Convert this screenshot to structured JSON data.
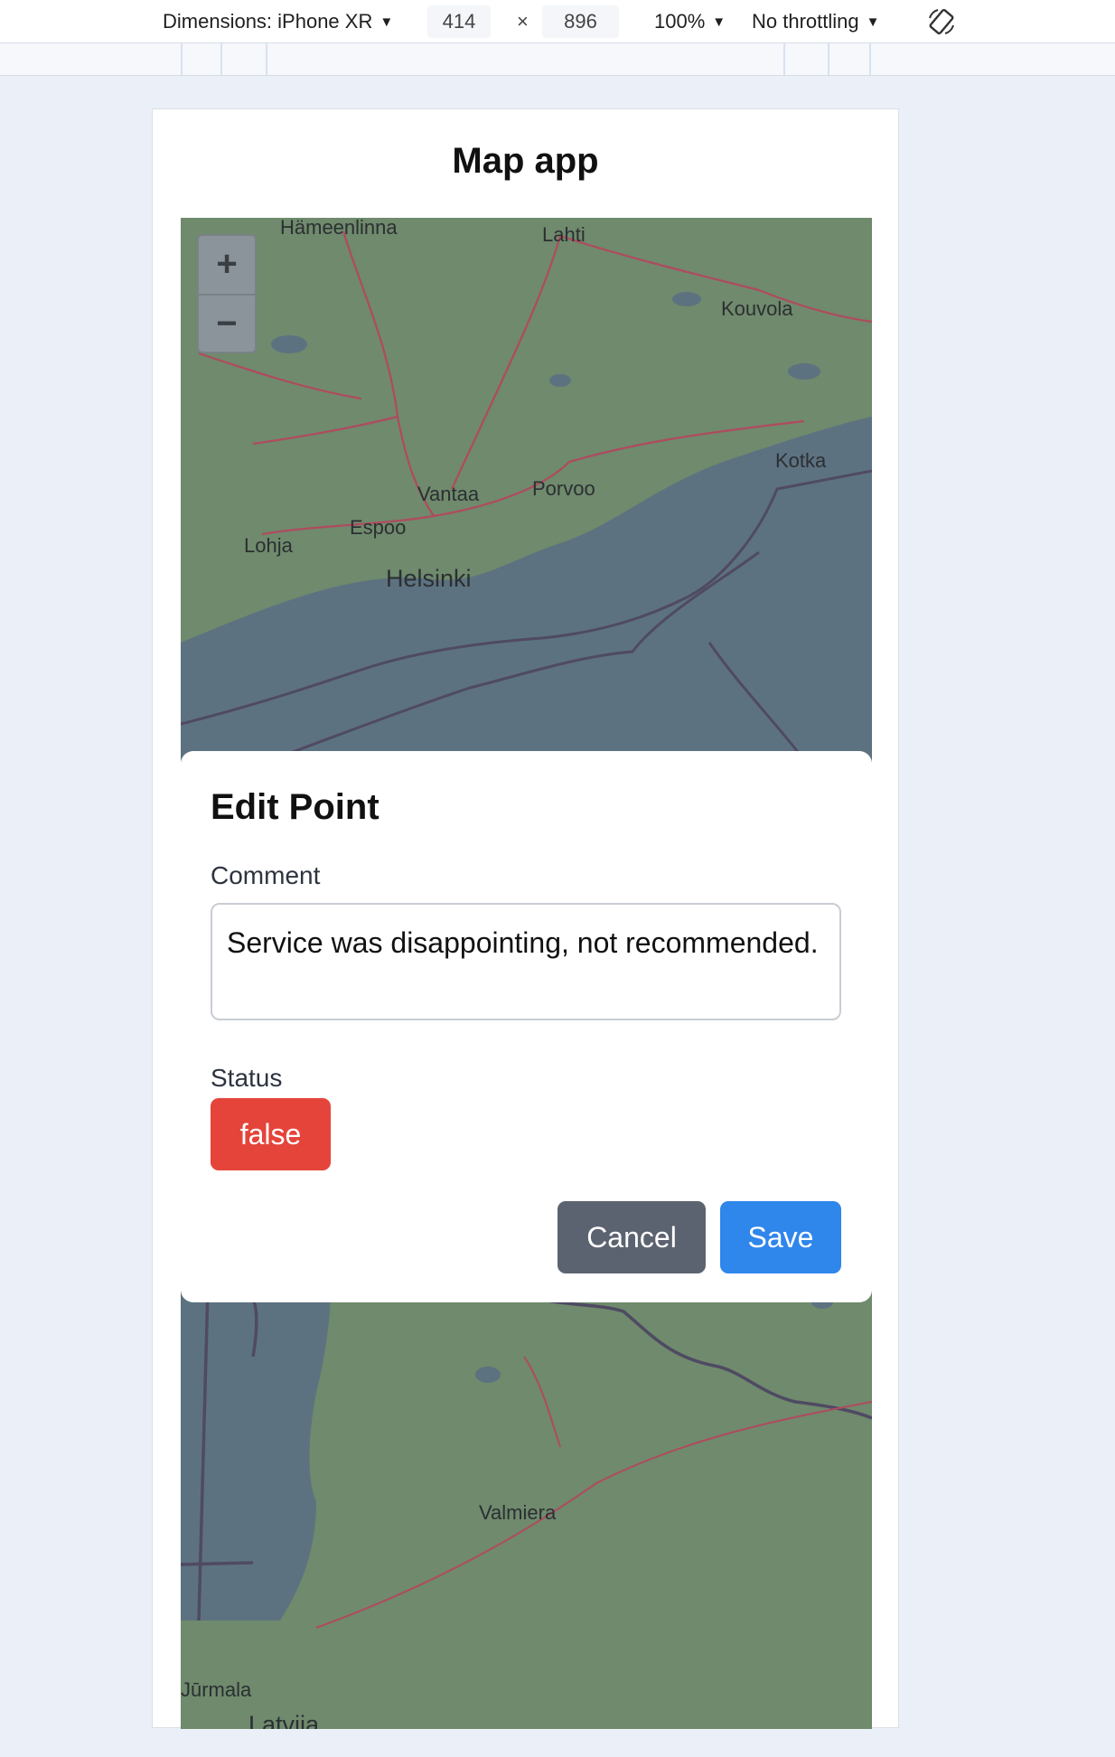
{
  "devtools": {
    "dimensions_label": "Dimensions: iPhone XR",
    "width": "414",
    "times": "×",
    "height": "896",
    "zoom": "100%",
    "throttling": "No throttling",
    "rotate_icon": "rotate-icon"
  },
  "app": {
    "title": "Map app"
  },
  "map": {
    "zoom_in": "+",
    "zoom_out": "−",
    "labels": {
      "hameenlinna": "Hämeenlinna",
      "lahti": "Lahti",
      "kouvola": "Kouvola",
      "kotka": "Kotka",
      "vantaa": "Vantaa",
      "porvoo": "Porvoo",
      "espoo": "Espoo",
      "lohja": "Lohja",
      "helsinki": "Helsinki",
      "valmiera": "Valmiera",
      "jurmala": "Jūrmala",
      "latvija": "Latvija"
    },
    "colors": {
      "land": "#6f8a6c",
      "sea": "#5d7280",
      "roads": "#b04a5f",
      "border": "#4f4a63"
    }
  },
  "modal": {
    "title": "Edit Point",
    "comment_label": "Comment",
    "comment_value": "Service was disappointing, not recommended.",
    "status_label": "Status",
    "status_value": "false",
    "cancel_label": "Cancel",
    "save_label": "Save",
    "colors": {
      "status": "#e5443b",
      "cancel": "#5c6370",
      "save": "#2f86eb"
    }
  }
}
